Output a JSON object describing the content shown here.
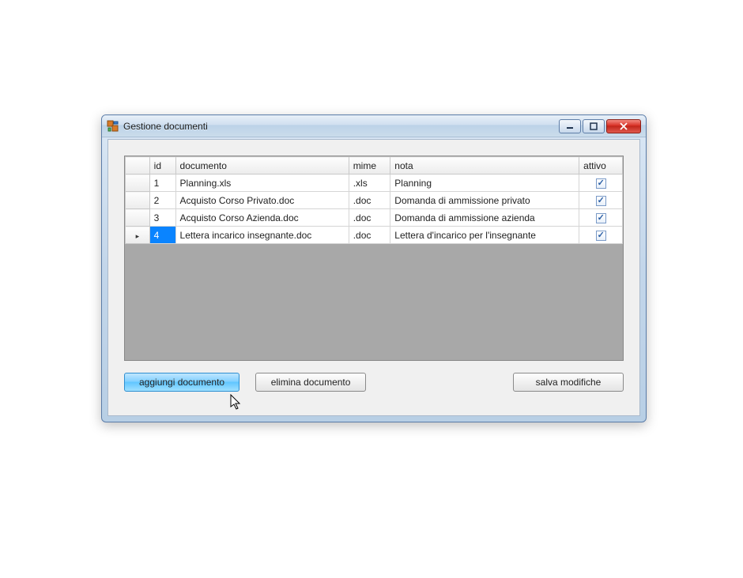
{
  "window": {
    "title": "Gestione documenti"
  },
  "columns": {
    "id": "id",
    "documento": "documento",
    "mime": "mime",
    "nota": "nota",
    "attivo": "attivo"
  },
  "rows": [
    {
      "id": "1",
      "documento": "Planning.xls",
      "mime": ".xls",
      "nota": "Planning",
      "attivo": true,
      "indicator": "",
      "selected": false
    },
    {
      "id": "2",
      "documento": "Acquisto Corso Privato.doc",
      "mime": ".doc",
      "nota": "Domanda di ammissione privato",
      "attivo": true,
      "indicator": "",
      "selected": false
    },
    {
      "id": "3",
      "documento": "Acquisto Corso Azienda.doc",
      "mime": ".doc",
      "nota": "Domanda di ammissione azienda",
      "attivo": true,
      "indicator": "",
      "selected": false
    },
    {
      "id": "4",
      "documento": "Lettera incarico insegnante.doc",
      "mime": ".doc",
      "nota": "Lettera d'incarico per l'insegnante",
      "attivo": true,
      "indicator": "▸",
      "selected": true
    }
  ],
  "buttons": {
    "add": "aggiungi documento",
    "delete": "elimina documento",
    "save": "salva modifiche"
  }
}
